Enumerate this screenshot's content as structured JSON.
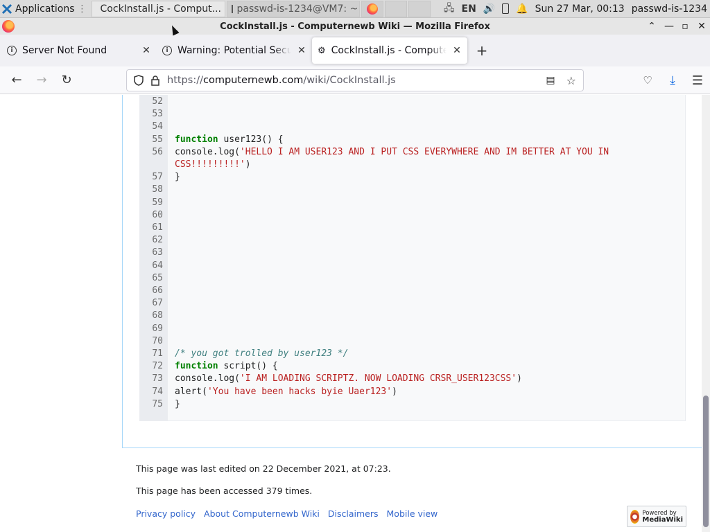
{
  "taskbar": {
    "apps_label": "Applications",
    "tasks": [
      {
        "label": "CockInstall.js - Comput..."
      },
      {
        "label": "passwd-is-1234@VM7: ~"
      }
    ],
    "lang": "EN",
    "clock": "Sun 27 Mar, 00:13",
    "user": "passwd-is-1234"
  },
  "window": {
    "title": "CockInstall.js - Computernewb Wiki — Mozilla Firefox"
  },
  "tabs": [
    {
      "label": "Server Not Found"
    },
    {
      "label": "Warning: Potential Security Risk Ahead"
    },
    {
      "label": "CockInstall.js - Computernewb Wiki"
    }
  ],
  "urlbar": {
    "scheme": "https://",
    "host": "computernewb.com",
    "path": "/wiki/CockInstall.js"
  },
  "code_lines": [
    {
      "n": "52",
      "code": ""
    },
    {
      "n": "53",
      "code": ""
    },
    {
      "n": "54",
      "code": ""
    },
    {
      "n": "55",
      "kw": "function",
      "rest": " user123() {"
    },
    {
      "n": "56",
      "pre": "console.log(",
      "str": "'HELLO I AM USER123 AND I PUT CSS EVERYWHERE AND IM BETTER AT YOU IN",
      "post": ""
    },
    {
      "n": "",
      "pre": "",
      "str": "CSS!!!!!!!!!'",
      "post": ")"
    },
    {
      "n": "57",
      "code": "}"
    },
    {
      "n": "58",
      "code": ""
    },
    {
      "n": "59",
      "code": ""
    },
    {
      "n": "60",
      "code": ""
    },
    {
      "n": "61",
      "code": ""
    },
    {
      "n": "62",
      "code": ""
    },
    {
      "n": "63",
      "code": ""
    },
    {
      "n": "64",
      "code": ""
    },
    {
      "n": "65",
      "code": ""
    },
    {
      "n": "66",
      "code": ""
    },
    {
      "n": "67",
      "code": ""
    },
    {
      "n": "68",
      "code": ""
    },
    {
      "n": "69",
      "code": ""
    },
    {
      "n": "70",
      "code": ""
    },
    {
      "n": "71",
      "cmt": "/* you got trolled by user123 */"
    },
    {
      "n": "72",
      "kw": "function",
      "rest": " script() {"
    },
    {
      "n": "73",
      "pre": "console.log(",
      "str": "'I AM LOADING SCRIPTZ. NOW LOADING CRSR_USER123CSS'",
      "post": ")"
    },
    {
      "n": "74",
      "pre": "alert(",
      "str": "'You have been hacks byie Uaer123'",
      "post": ")"
    },
    {
      "n": "75",
      "code": "}"
    }
  ],
  "footer": {
    "last_edited": "This page was last edited on 22 December 2021, at 07:23.",
    "accessed": "This page has been accessed 379 times.",
    "links": [
      "Privacy policy",
      "About Computernewb Wiki",
      "Disclaimers",
      "Mobile view"
    ],
    "powered_small": "Powered by",
    "powered_big": "MediaWiki"
  }
}
